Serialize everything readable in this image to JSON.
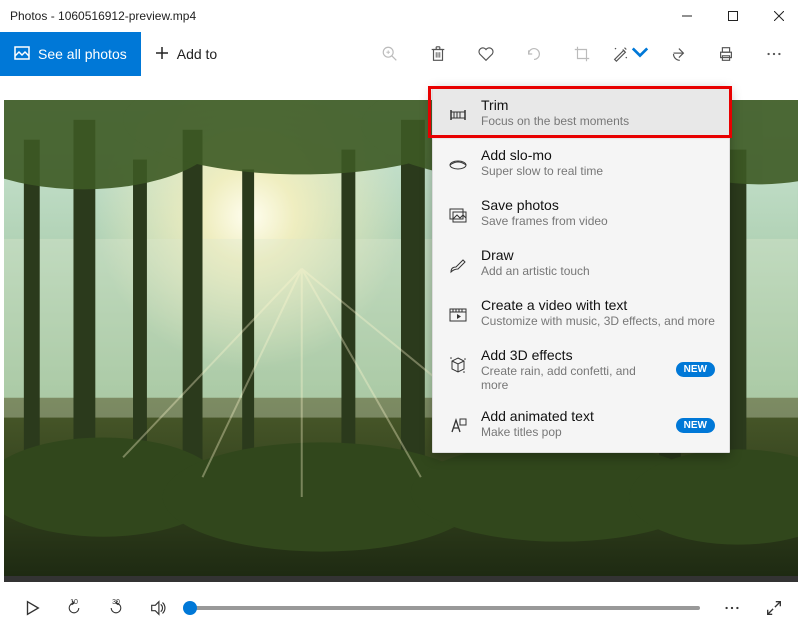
{
  "titlebar": {
    "title": "Photos - 1060516912-preview.mp4"
  },
  "toolbar": {
    "see_all": "See all photos",
    "add_to": "Add to"
  },
  "menu": [
    {
      "icon": "trim",
      "title": "Trim",
      "sub": "Focus on the best moments",
      "new": false,
      "hover": true
    },
    {
      "icon": "slomo",
      "title": "Add slo-mo",
      "sub": "Super slow to real time",
      "new": false
    },
    {
      "icon": "save",
      "title": "Save photos",
      "sub": "Save frames from video",
      "new": false
    },
    {
      "icon": "draw",
      "title": "Draw",
      "sub": "Add an artistic touch",
      "new": false
    },
    {
      "icon": "video",
      "title": "Create a video with text",
      "sub": "Customize with music, 3D effects, and more",
      "new": false
    },
    {
      "icon": "3d",
      "title": "Add 3D effects",
      "sub": "Create rain, add confetti, and more",
      "new": true
    },
    {
      "icon": "atext",
      "title": "Add animated text",
      "sub": "Make titles pop",
      "new": true
    }
  ],
  "badge_label": "NEW",
  "skip": {
    "back": "10",
    "fwd": "30"
  }
}
